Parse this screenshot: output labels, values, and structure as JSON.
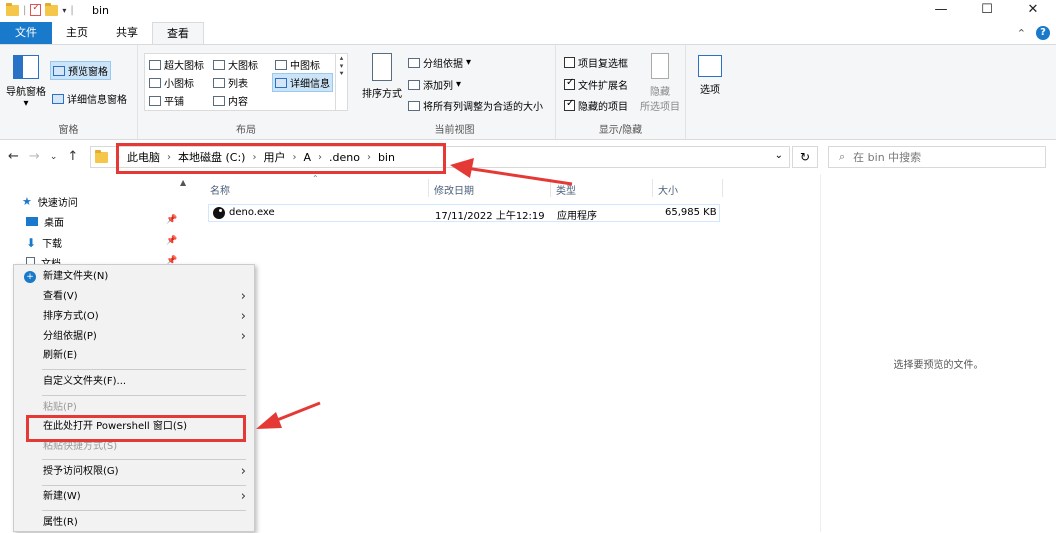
{
  "window": {
    "title": "bin",
    "controls": {
      "minimize": "—",
      "maximize": "☐",
      "close": "✕"
    }
  },
  "ribbon": {
    "tabs": [
      "文件",
      "主页",
      "共享",
      "查看"
    ],
    "active_tab": "查看",
    "collapse": "⌃",
    "help": "?",
    "panes_group": {
      "label": "窗格",
      "nav_pane": "导航窗格",
      "preview_pane": "预览窗格",
      "details_pane": "详细信息窗格"
    },
    "layout_group": {
      "label": "布局",
      "items": [
        "超大图标",
        "大图标",
        "中图标",
        "小图标",
        "列表",
        "详细信息",
        "平铺",
        "内容"
      ]
    },
    "current_view_group": {
      "label": "当前视图",
      "sort_by": "排序方式",
      "group_by": "分组依据",
      "add_columns": "添加列",
      "fit_columns": "将所有列调整为合适的大小"
    },
    "show_hide_group": {
      "label": "显示/隐藏",
      "item_checkboxes": {
        "label": "项目复选框",
        "checked": false
      },
      "file_extensions": {
        "label": "文件扩展名",
        "checked": true
      },
      "hidden_items": {
        "label": "隐藏的项目",
        "checked": true
      },
      "hide_selected": "隐藏",
      "hide_selected_sub": "所选项目",
      "options": "选项"
    }
  },
  "address_bar": {
    "crumbs": [
      "此电脑",
      "本地磁盘 (C:)",
      "用户",
      "A",
      ".deno",
      "bin"
    ],
    "search_placeholder": "在 bin 中搜索"
  },
  "nav_pane": {
    "items": [
      {
        "label": "快速访问",
        "pinned": false
      },
      {
        "label": "桌面",
        "pinned": true
      },
      {
        "label": "下载",
        "pinned": true
      },
      {
        "label": "文档",
        "pinned": true
      }
    ]
  },
  "file_list": {
    "columns": [
      "名称",
      "修改日期",
      "类型",
      "大小"
    ],
    "rows": [
      {
        "name": "deno.exe",
        "modified": "17/11/2022 上午12:19",
        "type": "应用程序",
        "size": "65,985 KB"
      }
    ]
  },
  "preview": {
    "empty_text": "选择要预览的文件。"
  },
  "context_menu": {
    "items": [
      {
        "label": "新建文件夹(N)",
        "submenu": false,
        "disabled": false
      },
      {
        "label": "查看(V)",
        "submenu": true,
        "disabled": false
      },
      {
        "label": "排序方式(O)",
        "submenu": true,
        "disabled": false
      },
      {
        "label": "分组依据(P)",
        "submenu": true,
        "disabled": false
      },
      {
        "label": "刷新(E)",
        "submenu": false,
        "disabled": false
      },
      {
        "label": "自定义文件夹(F)...",
        "submenu": false,
        "disabled": false
      },
      {
        "label": "粘贴(P)",
        "submenu": false,
        "disabled": true
      },
      {
        "label": "在此处打开 Powershell 窗口(S)",
        "submenu": false,
        "disabled": false
      },
      {
        "label": "粘贴快捷方式(S)",
        "submenu": false,
        "disabled": true
      },
      {
        "label": "授予访问权限(G)",
        "submenu": true,
        "disabled": false
      },
      {
        "label": "新建(W)",
        "submenu": true,
        "disabled": false
      },
      {
        "label": "属性(R)",
        "submenu": false,
        "disabled": false
      }
    ]
  },
  "annotation": {
    "highlight_color": "#e53935"
  }
}
